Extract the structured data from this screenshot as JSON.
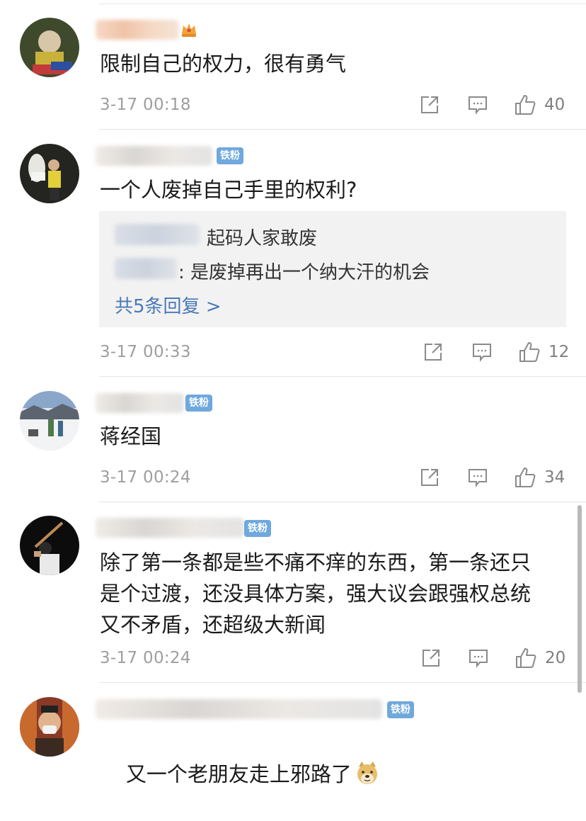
{
  "comments": [
    {
      "text": "限制自己的权力，很有勇气",
      "time": "3-17 00:18",
      "likes": "40",
      "badge": ""
    },
    {
      "text": "一个人废掉自己手里的权利?",
      "time": "3-17 00:33",
      "likes": "12",
      "badge": "铁粉",
      "replies": [
        {
          "text": "起码人家敢废"
        },
        {
          "text": ": 是废掉再出一个纳大汗的机会"
        }
      ],
      "more_replies": "共5条回复 >"
    },
    {
      "text": "蒋经国",
      "time": "3-17 00:24",
      "likes": "34",
      "badge": "铁粉"
    },
    {
      "text": "除了第一条都是些不痛不痒的东西，第一条还只\n是个过渡，还没具体方案，强大议会跟强权总统\n又不矛盾，还超级大新闻",
      "time": "3-17 00:24",
      "likes": "20",
      "badge": "铁粉"
    },
    {
      "text": "又一个老朋友走上邪路了",
      "badge": "铁粉"
    }
  ],
  "icons": {
    "share": "share-icon",
    "comment": "comment-icon",
    "like": "thumbs-up-icon",
    "crown": "crown-icon",
    "emoji": "doge-emoji-icon"
  },
  "colors": {
    "badge": "#6fa8dc",
    "link": "#4a7ab8",
    "meta": "#9e9e9e"
  }
}
